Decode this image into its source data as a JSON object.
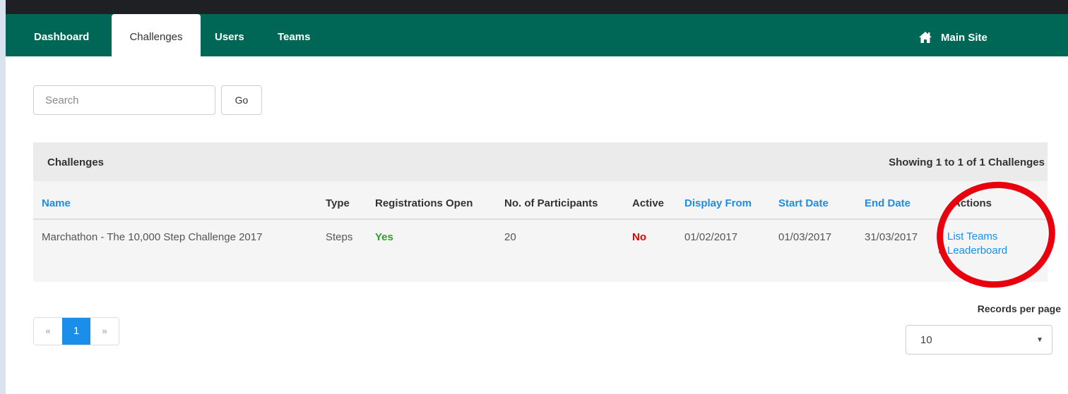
{
  "nav": {
    "items": [
      {
        "label": "Dashboard",
        "active": false
      },
      {
        "label": "Challenges",
        "active": true
      },
      {
        "label": "Users",
        "active": false
      },
      {
        "label": "Teams",
        "active": false
      }
    ],
    "main_site": "Main Site"
  },
  "search": {
    "placeholder": "Search",
    "go_label": "Go"
  },
  "panel": {
    "title": "Challenges",
    "count": "Showing 1 to 1 of 1 Challenges",
    "columns": {
      "name": "Name",
      "type": "Type",
      "registrations": "Registrations Open",
      "participants": "No. of Participants",
      "active": "Active",
      "display_from": "Display From",
      "start_date": "Start Date",
      "end_date": "End Date",
      "actions": "Actions"
    },
    "rows": [
      {
        "name": "Marchathon - The 10,000 Step Challenge 2017",
        "type": "Steps",
        "registrations": "Yes",
        "participants": "20",
        "active": "No",
        "display_from": "01/02/2017",
        "start_date": "01/03/2017",
        "end_date": "31/03/2017",
        "actions": [
          "List Teams",
          "Leaderboard"
        ]
      }
    ]
  },
  "pagination": {
    "prev": "«",
    "current": "1",
    "next": "»"
  },
  "records_per_page": {
    "label": "Records per page",
    "value": "10"
  },
  "colors": {
    "nav": "#006655",
    "link": "#1a8ee8",
    "yes": "#2aa52a",
    "no": "#e00000",
    "highlight": "#e8000f"
  }
}
